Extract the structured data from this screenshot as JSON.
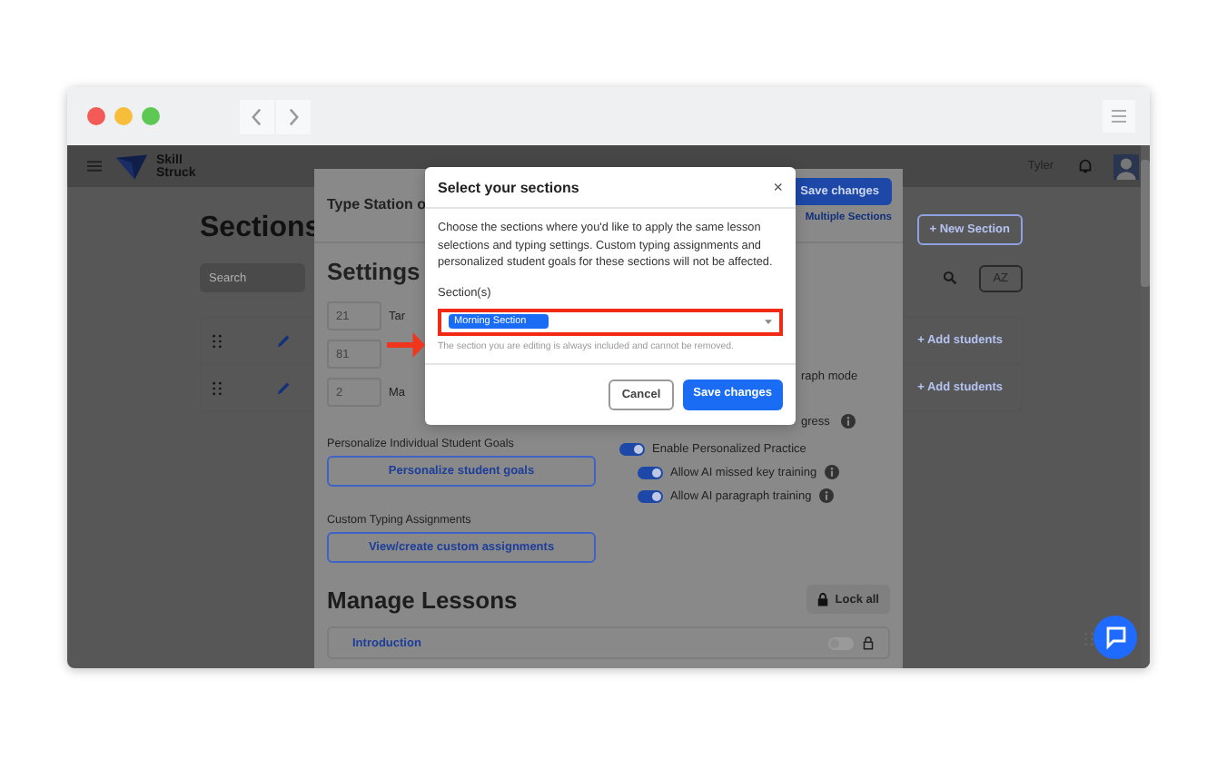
{
  "app_header": {
    "user_name": "Tyler",
    "logo_text": "Skill Struck"
  },
  "sections_page": {
    "title": "Sections",
    "search": {
      "placeholder": "Search"
    },
    "new_section_button": "+ New Section",
    "sort_button": "AZ",
    "rows": [
      {
        "action": "+ Add students"
      },
      {
        "action": "+ Add students"
      }
    ]
  },
  "panel": {
    "title": "Type Station o",
    "save_button": "Save changes",
    "multiple_sections_link": "Multiple Sections",
    "settings_heading": "Settings",
    "settings_fields": [
      {
        "value": "21",
        "label": "Tar"
      },
      {
        "value": "81"
      },
      {
        "value": "2",
        "label": "Ma"
      }
    ],
    "options": [
      {
        "label": "raph mode",
        "info": false
      },
      {
        "label": "gress",
        "info": true
      }
    ],
    "goals_label": "Personalize Individual Student Goals",
    "goals_button": "Personalize student goals",
    "toggles": [
      {
        "label": "Enable Personalized Practice",
        "on": true,
        "info": false,
        "children": [
          {
            "label": "Allow AI missed key training",
            "on": true,
            "info": true
          },
          {
            "label": "Allow AI paragraph training",
            "on": true,
            "info": true
          }
        ]
      }
    ],
    "custom_label": "Custom Typing Assignments",
    "custom_button": "View/create custom assignments",
    "lessons_heading": "Manage Lessons",
    "lock_all_button": "Lock all",
    "lessons": [
      {
        "name": "Introduction",
        "on": false
      }
    ]
  },
  "modal": {
    "title": "Select your sections",
    "close": "×",
    "description": "Choose the sections where you'd like to apply the same lesson selections and typing settings. Custom typing assignments and personalized student goals for these sections will not be affected.",
    "field_label": "Section(s)",
    "selected_tags": [
      "Morning Section"
    ],
    "hint": "The section you are editing is always included and cannot be removed.",
    "buttons": [
      {
        "label": "Cancel",
        "kind": "secondary"
      },
      {
        "label": "Save changes",
        "kind": "primary"
      }
    ]
  }
}
